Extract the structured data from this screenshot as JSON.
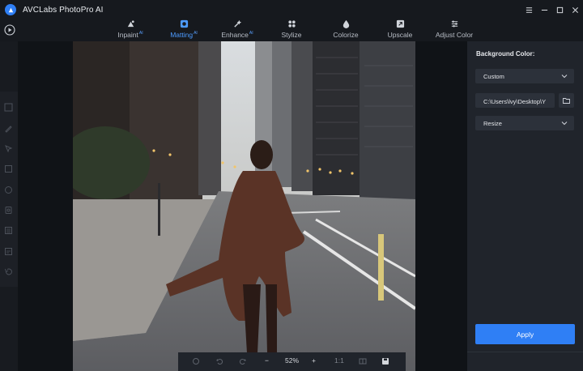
{
  "app": {
    "title": "AVCLabs PhotoPro AI",
    "accent": "#2f7ff5"
  },
  "window_controls": [
    {
      "name": "settings-icon"
    },
    {
      "name": "minimize-icon"
    },
    {
      "name": "maximize-icon"
    },
    {
      "name": "close-icon"
    }
  ],
  "toolbar": {
    "tabs": [
      {
        "label": "Inpaint",
        "badge": "AI",
        "icon": "inpaint-icon",
        "active": false
      },
      {
        "label": "Matting",
        "badge": "AI",
        "icon": "matting-icon",
        "active": true
      },
      {
        "label": "Enhance",
        "badge": "AI",
        "icon": "enhance-icon",
        "active": false
      },
      {
        "label": "Stylize",
        "badge": "",
        "icon": "stylize-icon",
        "active": false
      },
      {
        "label": "Colorize",
        "badge": "",
        "icon": "colorize-icon",
        "active": false
      },
      {
        "label": "Upscale",
        "badge": "",
        "icon": "upscale-icon",
        "active": false
      },
      {
        "label": "Adjust Color",
        "badge": "",
        "icon": "adjust-color-icon",
        "active": false
      }
    ]
  },
  "left_tools": [
    "checkbox-tool-icon",
    "brush-tool-icon",
    "select-tool-icon",
    "rectangle-tool-icon",
    "ellipse-tool-icon",
    "crop-tool-icon",
    "layer-tool-icon",
    "eraser-tool-icon",
    "history-tool-icon"
  ],
  "bottom_bar": {
    "zoom": "52%",
    "zoom_out": "−",
    "zoom_in": "+",
    "actual_size": "1:1"
  },
  "panel": {
    "background_color_label": "Background Color:",
    "background_color_value": "Custom",
    "path_value": "C:\\Users\\lvy\\Desktop\\Y",
    "resize_value": "Resize",
    "apply_label": "Apply"
  }
}
